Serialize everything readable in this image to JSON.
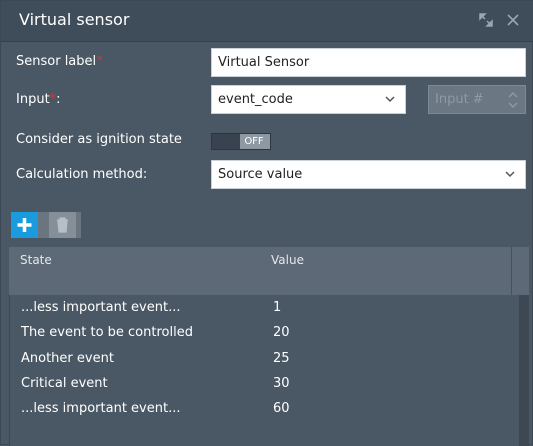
{
  "window": {
    "title": "Virtual sensor"
  },
  "form": {
    "sensor_label": "Sensor label",
    "sensor_value": "Virtual Sensor",
    "input_label": "Input",
    "input_value": "event_code",
    "input_number_placeholder": "Input #",
    "required_mark": "*",
    "ignition_label": "Consider as ignition state",
    "ignition_state": "OFF",
    "calc_label": "Calculation method:",
    "calc_value": "Source value"
  },
  "grid": {
    "columns": [
      "State",
      "Value"
    ],
    "rows": [
      {
        "state": "...less important event...",
        "value": "1"
      },
      {
        "state": "The event to be controlled",
        "value": "20"
      },
      {
        "state": "Another event",
        "value": "25"
      },
      {
        "state": "Critical event",
        "value": "30"
      },
      {
        "state": "...less important event...",
        "value": "60"
      }
    ]
  },
  "colors": {
    "accent": "#1a9be0",
    "background": "#4a5866",
    "required": "#e03030"
  }
}
